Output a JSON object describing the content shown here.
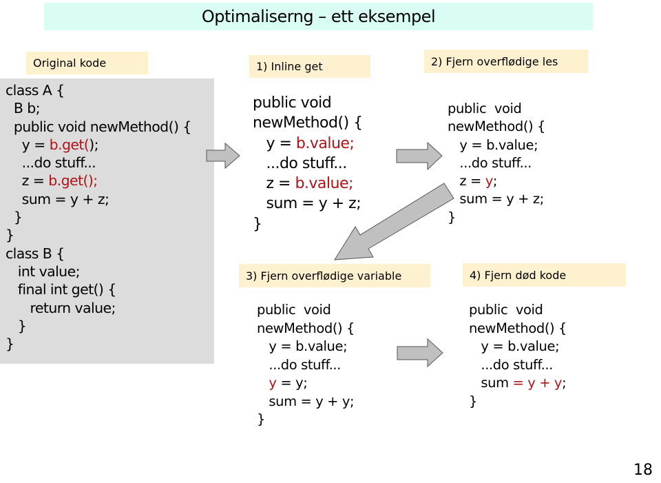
{
  "slide": {
    "title": "Optimaliserng – ett eksempel",
    "page_number": "18"
  },
  "original": {
    "label": "Original kode",
    "lines": [
      {
        "pre": "class A {",
        "hl": "",
        "post": ""
      },
      {
        "pre": "  B b;",
        "hl": "",
        "post": ""
      },
      {
        "pre": "  public void newMethod() {",
        "hl": "",
        "post": ""
      },
      {
        "pre": "    y = ",
        "hl": "b.get(",
        "post": ");"
      },
      {
        "pre": "    ...do stuff...",
        "hl": "",
        "post": ""
      },
      {
        "pre": "    z = ",
        "hl": "b.get();",
        "post": ""
      },
      {
        "pre": "    sum = y + z;",
        "hl": "",
        "post": ""
      },
      {
        "pre": "  }",
        "hl": "",
        "post": ""
      },
      {
        "pre": "}",
        "hl": "",
        "post": ""
      },
      {
        "pre": "class B {",
        "hl": "",
        "post": ""
      },
      {
        "pre": "   int value;",
        "hl": "",
        "post": ""
      },
      {
        "pre": "   final int get() {",
        "hl": "",
        "post": ""
      },
      {
        "pre": "      return value;",
        "hl": "",
        "post": ""
      },
      {
        "pre": "   }",
        "hl": "",
        "post": ""
      },
      {
        "pre": "}",
        "hl": "",
        "post": ""
      }
    ]
  },
  "step1": {
    "label": "1) Inline get",
    "lines": [
      {
        "pre": "public void",
        "hl": "",
        "post": ""
      },
      {
        "pre": "newMethod() {",
        "hl": "",
        "post": ""
      },
      {
        "pre": "   y = ",
        "hl": "b.value;",
        "post": ""
      },
      {
        "pre": "   ...do stuff...",
        "hl": "",
        "post": ""
      },
      {
        "pre": "   z = ",
        "hl": "b.value;",
        "post": ""
      },
      {
        "pre": "   sum = y + z;",
        "hl": "",
        "post": ""
      },
      {
        "pre": "}",
        "hl": "",
        "post": ""
      }
    ]
  },
  "step2": {
    "label": "2) Fjern overflødige les",
    "lines": [
      {
        "pre": "public  void",
        "hl": "",
        "post": ""
      },
      {
        "pre": "newMethod() {",
        "hl": "",
        "post": ""
      },
      {
        "pre": "   y = b.value;",
        "hl": "",
        "post": ""
      },
      {
        "pre": "   ...do stuff...",
        "hl": "",
        "post": ""
      },
      {
        "pre": "   z = ",
        "hl": "y",
        "post": ";"
      },
      {
        "pre": "   sum = y + z;",
        "hl": "",
        "post": ""
      },
      {
        "pre": "}",
        "hl": "",
        "post": ""
      }
    ]
  },
  "step3": {
    "label": "3) Fjern overflødige variable",
    "lines": [
      {
        "pre": "public  void",
        "hl": "",
        "post": ""
      },
      {
        "pre": "newMethod() {",
        "hl": "",
        "post": ""
      },
      {
        "pre": "   y = b.value;",
        "hl": "",
        "post": ""
      },
      {
        "pre": "   ...do stuff...",
        "hl": "",
        "post": ""
      },
      {
        "pre": "   ",
        "hl": "y",
        "post": " = y;"
      },
      {
        "pre": "   sum = y + y;",
        "hl": "",
        "post": ""
      },
      {
        "pre": "}",
        "hl": "",
        "post": ""
      }
    ]
  },
  "step4": {
    "label": "4) Fjern død kode",
    "lines": [
      {
        "pre": "public  void",
        "hl": "",
        "post": ""
      },
      {
        "pre": "newMethod() {",
        "hl": "",
        "post": ""
      },
      {
        "pre": "   y = b.value;",
        "hl": "",
        "post": ""
      },
      {
        "pre": "   ...do stuff...",
        "hl": "",
        "post": ""
      },
      {
        "pre": "   sum ",
        "hl": "= y + y",
        "post": ";"
      },
      {
        "pre": "}",
        "hl": "",
        "post": ""
      }
    ]
  },
  "colors": {
    "title_bg": "#d9fdf4",
    "label_bg": "#fdf1cf",
    "code_box_bg": "#dcdcdc",
    "highlight": "#b01217",
    "arrow_fill": "#c0c0c0",
    "arrow_stroke": "#555555"
  }
}
